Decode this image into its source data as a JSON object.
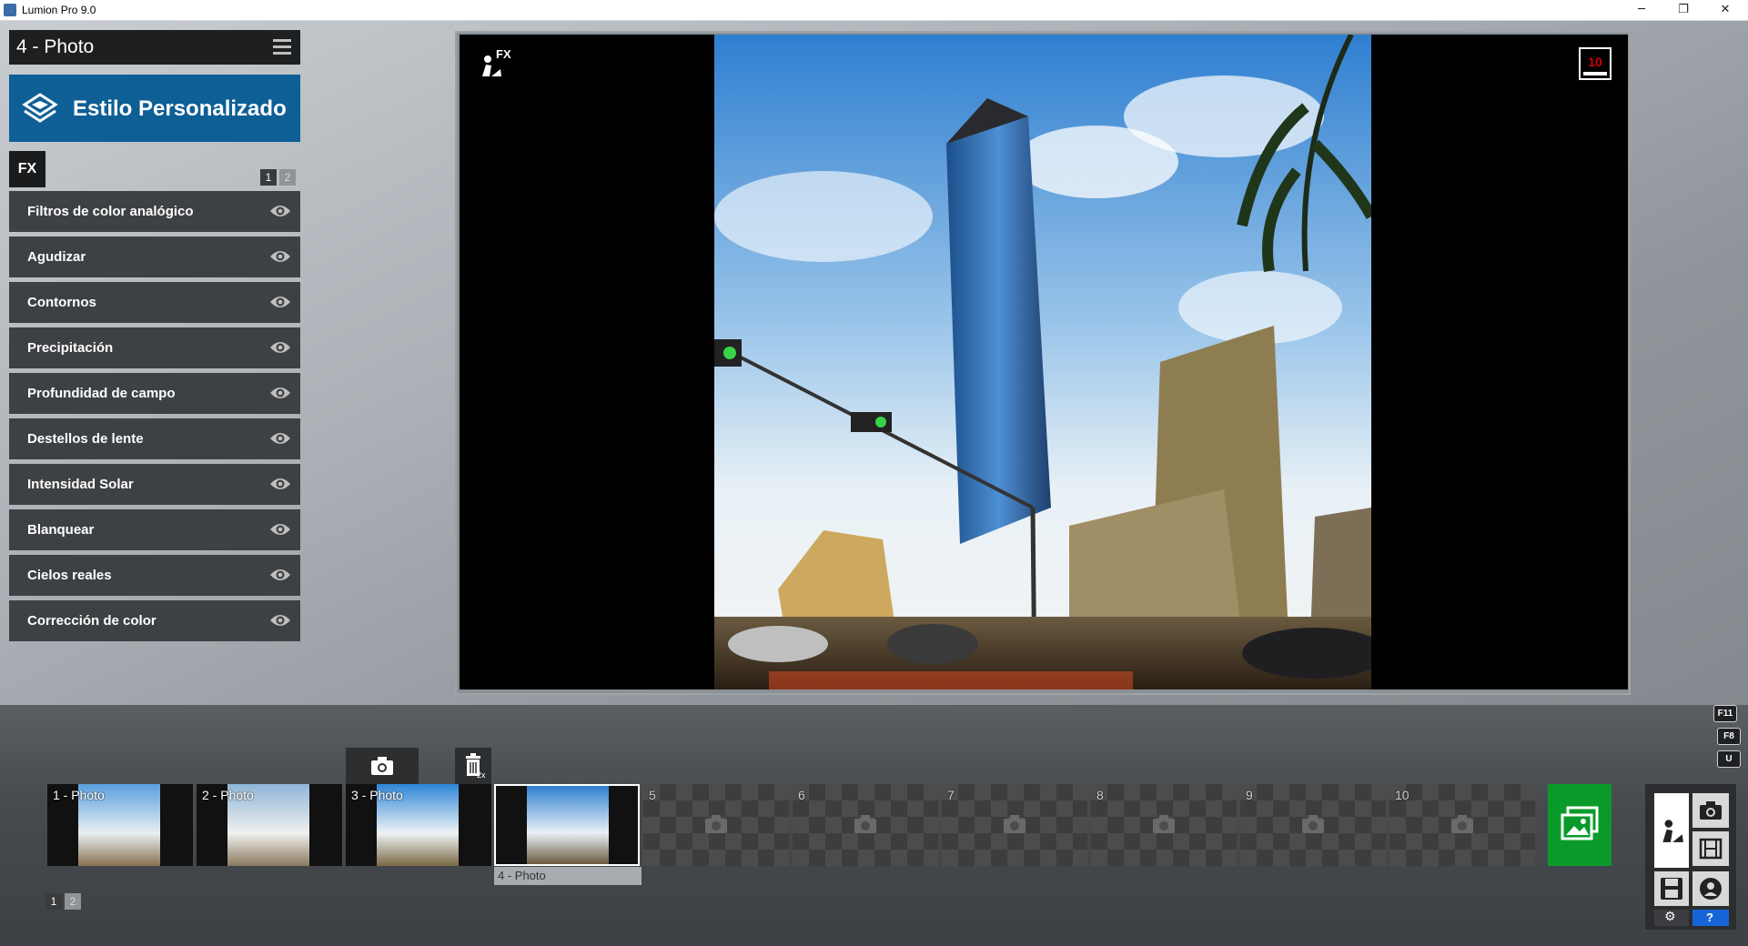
{
  "window": {
    "title": "Lumion Pro 9.0",
    "minimize": "─",
    "maximize": "❐",
    "close": "✕"
  },
  "panel": {
    "photo_title": "4 - Photo",
    "style_button": "Estilo Personalizado",
    "fx_tab": "FX",
    "fx_pages": [
      "1",
      "2"
    ],
    "effects": [
      {
        "label": "Filtros de color analógico"
      },
      {
        "label": "Agudizar"
      },
      {
        "label": "Contornos"
      },
      {
        "label": "Precipitación"
      },
      {
        "label": "Profundidad de campo"
      },
      {
        "label": "Destellos de lente"
      },
      {
        "label": "Intensidad Solar"
      },
      {
        "label": "Blanquear"
      },
      {
        "label": "Cielos reales"
      },
      {
        "label": "Corrección de color"
      }
    ]
  },
  "viewport": {
    "fx_label": "FX",
    "counter": "10"
  },
  "keys": [
    "F11",
    "F8",
    "U"
  ],
  "filmstrip": {
    "slots": [
      {
        "label": "1 - Photo",
        "filled": true
      },
      {
        "label": "2 - Photo",
        "filled": true
      },
      {
        "label": "3 - Photo",
        "filled": true
      },
      {
        "label": "",
        "filled": true,
        "selected": true
      },
      {
        "label": "5",
        "filled": false
      },
      {
        "label": "6",
        "filled": false
      },
      {
        "label": "7",
        "filled": false
      },
      {
        "label": "8",
        "filled": false
      },
      {
        "label": "9",
        "filled": false
      },
      {
        "label": "10",
        "filled": false
      }
    ],
    "selected_caption": "4 - Photo",
    "delete_badge": "2x",
    "pages": [
      "1",
      "2"
    ]
  },
  "modes": {
    "help": "?"
  },
  "colors": {
    "accent_blue": "#0e5f96",
    "render_green": "#0a9a2a",
    "counter_red": "#d40000"
  }
}
